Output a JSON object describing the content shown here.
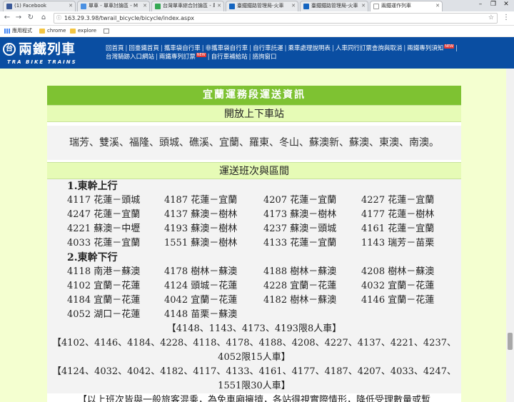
{
  "browser": {
    "tabs": [
      {
        "label": "(1) Facebook",
        "color": "#3b5998"
      },
      {
        "label": "單車 - 單車討論區 - M",
        "color": "#4a90e2"
      },
      {
        "label": "台灣單車綜合討論區 - 單",
        "color": "#34a853"
      },
      {
        "label": "臺鐵鐵路管理局-火車",
        "color": "#1565c0"
      },
      {
        "label": "臺鐵鐵路管理局-火車",
        "color": "#1565c0"
      },
      {
        "label": "兩鐵運作列車",
        "color": "#cccccc"
      }
    ],
    "url": "163.29.3.98/twrail_bicycle/bicycle/index.aspx",
    "bookmarks": [
      "應用程式",
      "chrome",
      "explore"
    ]
  },
  "site": {
    "logo_title": "兩鐵列車",
    "logo_sub": "TRA BIKE TRAINS",
    "logo_mark": "台",
    "nav": [
      {
        "label": "回首頁",
        "new": false
      },
      {
        "label": "回臺鐵首頁",
        "new": false
      },
      {
        "label": "攜車袋自行車",
        "new": false
      },
      {
        "label": "非攜車袋自行車",
        "new": false
      },
      {
        "label": "自行車託運",
        "new": false
      },
      {
        "label": "乘車處理說明表",
        "new": false
      },
      {
        "label": "人車同行訂票查詢與取消",
        "new": false
      },
      {
        "label": "兩鐵專列須知",
        "new": true
      },
      {
        "label": "台灣騎跡入口網站",
        "new": false
      },
      {
        "label": "兩鐵專列訂票",
        "new": true
      },
      {
        "label": "自行車補給站",
        "new": false
      },
      {
        "label": "諮詢窗口",
        "new": false
      }
    ],
    "new_badge": "NEW"
  },
  "main": {
    "section_title": "宜蘭運務段運送資訊",
    "stations_header": "開放上下車站",
    "stations": "瑞芳、雙溪、福隆、頭城、礁溪、宜蘭、羅東、冬山、蘇澳新、蘇澳、東澳、南澳。",
    "schedule_header": "運送班次與區間",
    "groups": [
      {
        "title": "1.東幹上行",
        "rows": [
          [
            "4117 花蓮－頭城",
            "4187 花蓮－宜蘭",
            "4207 花蓮－宜蘭",
            "4227 花蓮－宜蘭"
          ],
          [
            "4247 花蓮－宜蘭",
            "4137 蘇澳－樹林",
            "4173 蘇澳－樹林",
            "4177 花蓮－樹林"
          ],
          [
            "4221 蘇澳－中壢",
            "4193 蘇澳－樹林",
            "4237 蘇澳－頭城",
            "4161 花蓮－宜蘭"
          ],
          [
            "4033 花蓮－宜蘭",
            "1551 蘇澳－樹林",
            "4133 花蓮－宜蘭",
            "1143 瑞芳－苗栗"
          ]
        ]
      },
      {
        "title": "2.東幹下行",
        "rows": [
          [
            "4118 南港－蘇澳",
            "4178 樹林－蘇澳",
            "4188 樹林－蘇澳",
            "4208 樹林－蘇澳"
          ],
          [
            "4102 宜蘭－花蓮",
            "4124 頭城－花蓮",
            "4228 宜蘭－花蓮",
            "4032 宜蘭－花蓮"
          ],
          [
            "4184 宜蘭－花蓮",
            "4042 宜蘭－花蓮",
            "4182 樹林－蘇澳",
            "4146 宜蘭－花蓮"
          ],
          [
            "4052 湖口－花蓮",
            "4148 苗栗－蘇澳"
          ]
        ]
      }
    ],
    "notes": [
      "【4148、1143、4173、4193限8人車】",
      "【4102、4146、4184、4228、4118、4178、4188、4208、4227、4137、4221、4237、",
      "4052限15人車】",
      "【4124、4032、4042、4182、4117、4133、4161、4177、4187、4207、4033、4247、",
      "1551限30人車】",
      "【以上班次皆與一般旅客混乘，為免車廂擁擠，各站得視實際情形，降低受理數量或暫"
    ]
  }
}
